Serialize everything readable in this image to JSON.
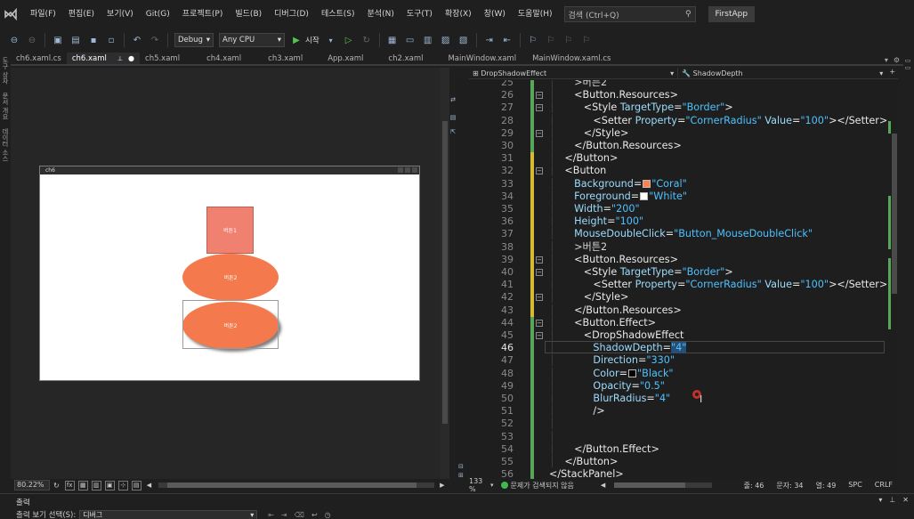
{
  "menubar": {
    "items": [
      "파일(F)",
      "편집(E)",
      "보기(V)",
      "Git(G)",
      "프로젝트(P)",
      "빌드(B)",
      "디버그(D)",
      "테스트(S)",
      "분석(N)",
      "도구(T)",
      "확장(X)",
      "창(W)",
      "도움말(H)"
    ],
    "search_placeholder": "검색 (Ctrl+Q)",
    "app_name": "FirstApp"
  },
  "toolbar": {
    "config": "Debug",
    "platform": "Any CPU",
    "start_label": "시작"
  },
  "left_strip": {
    "items": [
      "도구 상자",
      "문서 개요",
      "데이터 소스"
    ]
  },
  "tabs": [
    {
      "label": "ch6.xaml.cs",
      "active": false
    },
    {
      "label": "ch6.xaml",
      "active": true,
      "modified": true
    },
    {
      "label": "ch5.xaml",
      "active": false
    },
    {
      "label": "ch4.xaml",
      "active": false
    },
    {
      "label": "ch3.xaml",
      "active": false
    },
    {
      "label": "App.xaml",
      "active": false
    },
    {
      "label": "ch2.xaml",
      "active": false
    },
    {
      "label": "MainWindow.xaml",
      "active": false
    },
    {
      "label": "MainWindow.xaml.cs",
      "active": false
    }
  ],
  "designer": {
    "window_title": "ch6",
    "button1_label": "버튼1",
    "button2_label": "버튼2",
    "button3_label": "버튼2",
    "zoom": "80.22%",
    "fx_label": "fx"
  },
  "navbar": {
    "left": "DropShadowEffect",
    "right": "ShadowDepth"
  },
  "code": {
    "current_line": 46,
    "lines": [
      {
        "n": 25,
        "html": "<span class='guide'>│      </span><span class='txt'>&gt;버튼2</span>"
      },
      {
        "n": 26,
        "html": "<span class='guide'>│      </span><span class='t'>&lt;Button.Resources&gt;</span>"
      },
      {
        "n": 27,
        "html": "<span class='guide'>│         </span><span class='t'>&lt;Style </span><span class='a'>TargetType</span><span class='t'>=</span><span class='v'>\"Border\"</span><span class='t'>&gt;</span>"
      },
      {
        "n": 28,
        "html": "<span class='guide'>│            </span><span class='t'>&lt;Setter </span><span class='a'>Property</span><span class='t'>=</span><span class='v'>\"CornerRadius\"</span><span class='a'> Value</span><span class='t'>=</span><span class='v'>\"100\"</span><span class='t'>&gt;&lt;/Setter&gt;</span>"
      },
      {
        "n": 29,
        "html": "<span class='guide'>│         </span><span class='t'>&lt;/Style&gt;</span>"
      },
      {
        "n": 30,
        "html": "<span class='guide'>│      </span><span class='t'>&lt;/Button.Resources&gt;</span>"
      },
      {
        "n": 31,
        "html": "<span class='guide'>│   </span><span class='t'>&lt;/Button&gt;</span>"
      },
      {
        "n": 32,
        "html": "<span class='guide'>│   </span><span class='t'>&lt;Button</span>"
      },
      {
        "n": 33,
        "html": "<span class='guide'>│      </span><span class='a'>Background</span><span class='t'>=</span><span class='swatch' style='background:#ff7f50'></span><span class='v'>\"Coral\"</span>"
      },
      {
        "n": 34,
        "html": "<span class='guide'>│      </span><span class='a'>Foreground</span><span class='t'>=</span><span class='swatch' style='background:#ffffff'></span><span class='v'>\"White\"</span>"
      },
      {
        "n": 35,
        "html": "<span class='guide'>│      </span><span class='a'>Width</span><span class='t'>=</span><span class='v'>\"200\"</span>"
      },
      {
        "n": 36,
        "html": "<span class='guide'>│      </span><span class='a'>Height</span><span class='t'>=</span><span class='v'>\"100\"</span>"
      },
      {
        "n": 37,
        "html": "<span class='guide'>│      </span><span class='a'>MouseDoubleClick</span><span class='t'>=</span><span class='v'>\"Button_MouseDoubleClick\"</span>"
      },
      {
        "n": 38,
        "html": "<span class='guide'>│      </span><span class='txt'>&gt;버튼2</span>"
      },
      {
        "n": 39,
        "html": "<span class='guide'>│      </span><span class='t'>&lt;Button.Resources&gt;</span>"
      },
      {
        "n": 40,
        "html": "<span class='guide'>│         </span><span class='t'>&lt;Style </span><span class='a'>TargetType</span><span class='t'>=</span><span class='v'>\"Border\"</span><span class='t'>&gt;</span>"
      },
      {
        "n": 41,
        "html": "<span class='guide'>│            </span><span class='t'>&lt;Setter </span><span class='a'>Property</span><span class='t'>=</span><span class='v'>\"CornerRadius\"</span><span class='a'> Value</span><span class='t'>=</span><span class='v'>\"100\"</span><span class='t'>&gt;&lt;/Setter&gt;</span>"
      },
      {
        "n": 42,
        "html": "<span class='guide'>│         </span><span class='t'>&lt;/Style&gt;</span>"
      },
      {
        "n": 43,
        "html": "<span class='guide'>│      </span><span class='t'>&lt;/Button.Resources&gt;</span>"
      },
      {
        "n": 44,
        "html": "<span class='guide'>│      </span><span class='t'>&lt;Button.Effect&gt;</span>"
      },
      {
        "n": 45,
        "html": "<span class='guide'>│         </span><span class='t'>&lt;DropShadowEffect</span>"
      },
      {
        "n": 46,
        "html": "<span class='guide'>│            </span><span class='a'>ShadowDepth</span><span class='t'>=</span><span class='v' style='background:#264f78'>\"4\"</span>"
      },
      {
        "n": 47,
        "html": "<span class='guide'>│            </span><span class='a'>Direction</span><span class='t'>=</span><span class='v'>\"330\"</span>"
      },
      {
        "n": 48,
        "html": "<span class='guide'>│            </span><span class='a'>Color</span><span class='t'>=</span><span class='swatch' style='background:#000000'></span><span class='v'>\"Black\"</span>"
      },
      {
        "n": 49,
        "html": "<span class='guide'>│            </span><span class='a'>Opacity</span><span class='t'>=</span><span class='v'>\"0.5\"</span>"
      },
      {
        "n": 50,
        "html": "<span class='guide'>│            </span><span class='a'>BlurRadius</span><span class='t'>=</span><span class='v'>\"4\"</span>"
      },
      {
        "n": 51,
        "html": "<span class='guide'>│            </span><span class='t'>/&gt;</span>"
      },
      {
        "n": 52,
        "html": "<span class='guide'>│</span>"
      },
      {
        "n": 53,
        "html": "<span class='guide'>│</span>"
      },
      {
        "n": 54,
        "html": "<span class='guide'>│      </span><span class='t'>&lt;/Button.Effect&gt;</span>"
      },
      {
        "n": 55,
        "html": "<span class='guide'>│   </span><span class='t'>&lt;/Button&gt;</span>"
      },
      {
        "n": 56,
        "html": "<span class='t'>&lt;/StackPanel&gt;</span>"
      }
    ],
    "fold_lines": [
      26,
      27,
      29,
      32,
      39,
      40,
      42,
      44,
      45
    ]
  },
  "editor_status": {
    "zoom": "133 %",
    "issues": "문제가 검색되지 않음",
    "line": "줄: 46",
    "char": "문자: 34",
    "col": "열: 49",
    "spc": "SPC",
    "eol": "CRLF"
  },
  "output": {
    "title": "출력",
    "source_label": "출력 보기 선택(S):",
    "source_value": "디버그"
  }
}
